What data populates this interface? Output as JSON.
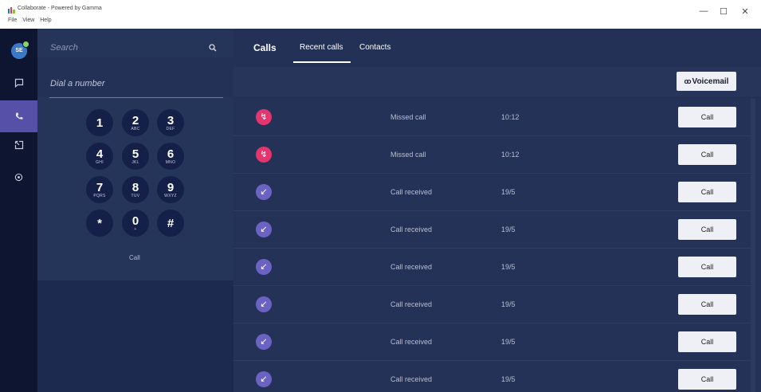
{
  "window": {
    "title": "Collaborate - Powered by Gamma",
    "menu": [
      "File",
      "View",
      "Help"
    ],
    "controls": [
      "—",
      "☐",
      "✕"
    ]
  },
  "rail": {
    "avatar_initials": "SE",
    "items": [
      "chat-icon",
      "phone-icon",
      "share-icon",
      "settings-icon"
    ],
    "active_item": "phone-icon"
  },
  "dialer": {
    "search_placeholder": "Search",
    "dial_placeholder": "Dial a number",
    "keys": [
      {
        "digit": "1",
        "sub": ""
      },
      {
        "digit": "2",
        "sub": "ABC"
      },
      {
        "digit": "3",
        "sub": "DEF"
      },
      {
        "digit": "4",
        "sub": "GHI"
      },
      {
        "digit": "5",
        "sub": "JKL"
      },
      {
        "digit": "6",
        "sub": "MNO"
      },
      {
        "digit": "7",
        "sub": "PQRS"
      },
      {
        "digit": "8",
        "sub": "TUV"
      },
      {
        "digit": "9",
        "sub": "WXYZ"
      },
      {
        "digit": "*",
        "sub": ""
      },
      {
        "digit": "0",
        "sub": "+"
      },
      {
        "digit": "#",
        "sub": ""
      }
    ],
    "call_label": "Call"
  },
  "calls": {
    "tabs": [
      "Calls",
      "Recent calls",
      "Contacts"
    ],
    "active_tab": "Recent calls",
    "voicemail_label": "Voicemail",
    "rows": [
      {
        "type": "missed",
        "status": "Missed call",
        "time": "10:12",
        "button": "Call"
      },
      {
        "type": "missed",
        "status": "Missed call",
        "time": "10:12",
        "button": "Call"
      },
      {
        "type": "received",
        "status": "Call received",
        "time": "19/5",
        "button": "Call"
      },
      {
        "type": "received",
        "status": "Call received",
        "time": "19/5",
        "button": "Call"
      },
      {
        "type": "received",
        "status": "Call received",
        "time": "19/5",
        "button": "Call"
      },
      {
        "type": "received",
        "status": "Call received",
        "time": "19/5",
        "button": "Call"
      },
      {
        "type": "received",
        "status": "Call received",
        "time": "19/5",
        "button": "Call"
      },
      {
        "type": "received",
        "status": "Call received",
        "time": "19/5",
        "button": "Call"
      }
    ]
  },
  "colors": {
    "missed": "#e5356e",
    "received": "#6a63c4",
    "rail_active": "#5650a8"
  }
}
